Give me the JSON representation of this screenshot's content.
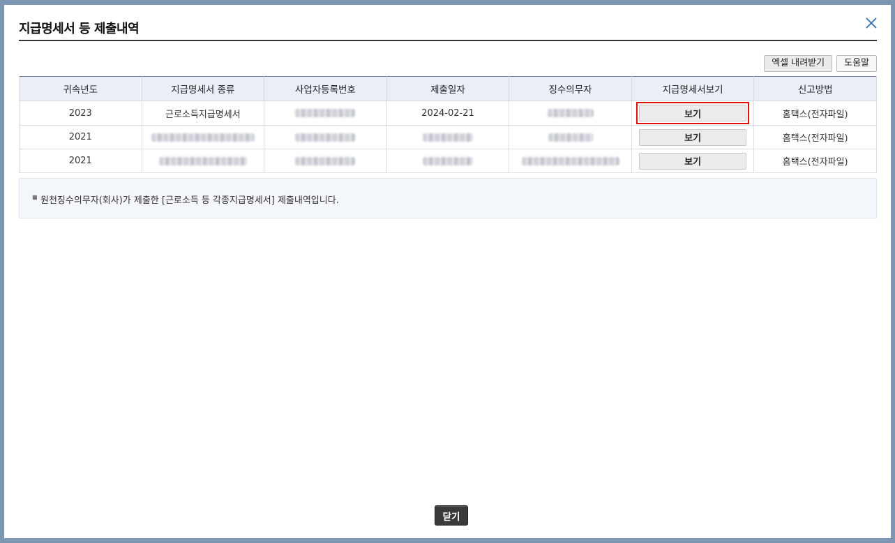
{
  "dialog": {
    "title": "지급명세서 등 제출내역",
    "close_icon": "close-icon"
  },
  "toolbar": {
    "excel_label": "엑셀 내려받기",
    "help_label": "도움말"
  },
  "table": {
    "headers": [
      "귀속년도",
      "지급명세서 종류",
      "사업자등록번호",
      "제출일자",
      "징수의무자",
      "지급명세서보기",
      "신고방법"
    ],
    "rows": [
      {
        "year": "2023",
        "type": "근로소득지급명세서",
        "date": "2024-02-21",
        "view": "보기",
        "method": "홈택스(전자파일)"
      },
      {
        "year": "2021",
        "view": "보기",
        "method": "홈택스(전자파일)"
      },
      {
        "year": "2021",
        "view": "보기",
        "method": "홈택스(전자파일)"
      }
    ]
  },
  "notice": {
    "text": "원천징수의무자(회사)가 제출한 [근로소득 등 각종지급명세서] 제출내역입니다."
  },
  "footer": {
    "close_label": "닫기"
  },
  "colors": {
    "highlight": "#e01010",
    "header_bg": "#e9eef7"
  }
}
